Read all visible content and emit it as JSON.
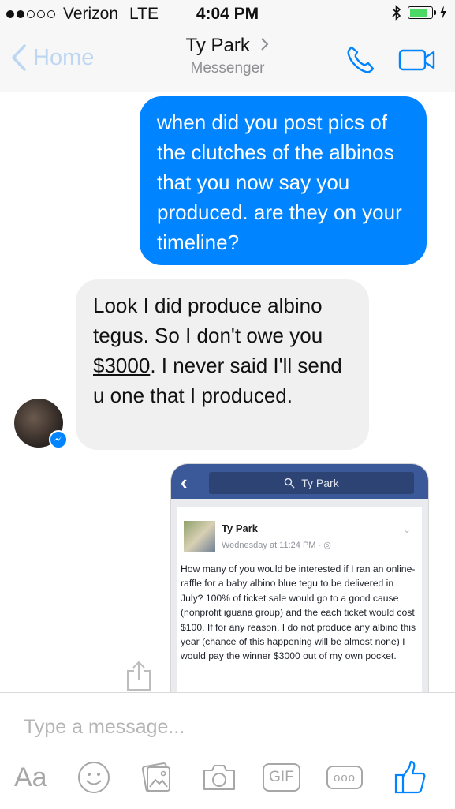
{
  "status_bar": {
    "carrier": "Verizon",
    "network": "LTE",
    "time": "4:04 PM",
    "battery_level": 0.8
  },
  "nav": {
    "back_label": "Home",
    "title": "Ty Park",
    "subtitle": "Messenger",
    "icons": [
      "phone-icon",
      "video-camera-icon"
    ]
  },
  "messages": {
    "outgoing_1": {
      "text": "when did you post pics of the clutches of the albinos that you now say you produced. are they on your timeline?"
    },
    "incoming_1": {
      "text_before": "Look I did produce albino tegus. So I don't owe you ",
      "amount": "$3000",
      "text_after": ". I never said I'll send u one that I produced."
    }
  },
  "screenshot": {
    "search_text": "Ty Park",
    "poster": "Ty Park",
    "timestamp": "Wednesday at 11:24 PM · ",
    "post": "How many of you would be interested if I ran an online-raffle for a baby albino blue tegu to be delivered in July? 100% of ticket sale would go to a good cause (nonprofit iguana group) and the each ticket would cost $100. If for any reason, I do not produce any albino this year (chance of this happening will be almost none) I would pay the winner $3000 out of my own pocket."
  },
  "composer": {
    "placeholder": "Type a message...",
    "aa_label": "Aa",
    "gif_label": "GIF",
    "more_label": "ooo"
  },
  "colors": {
    "accent": "#0084ff",
    "facebook_blue": "#3b5998",
    "incoming_bubble": "#f1f0f0"
  }
}
